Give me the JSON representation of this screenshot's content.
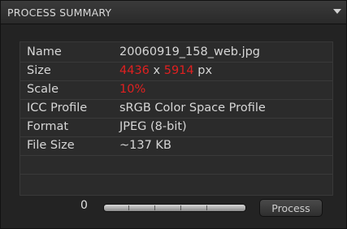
{
  "panel": {
    "title": "PROCESS SUMMARY"
  },
  "info": {
    "name_label": "Name",
    "name_value": "20060919_158_web.jpg",
    "size_label": "Size",
    "size_width": "4436",
    "size_x": "x",
    "size_height": "5914",
    "size_unit": "px",
    "scale_label": "Scale",
    "scale_value": "10%",
    "icc_label": "ICC Profile",
    "icc_value": "sRGB Color Space Profile",
    "format_label": "Format",
    "format_value": "JPEG (8-bit)",
    "filesize_label": "File Size",
    "filesize_value": "~137 KB"
  },
  "controls": {
    "slider_value": "0",
    "process_label": "Process"
  },
  "colors": {
    "highlight": "#e02020"
  },
  "icons": {
    "collapse": "triangle-down-icon"
  }
}
